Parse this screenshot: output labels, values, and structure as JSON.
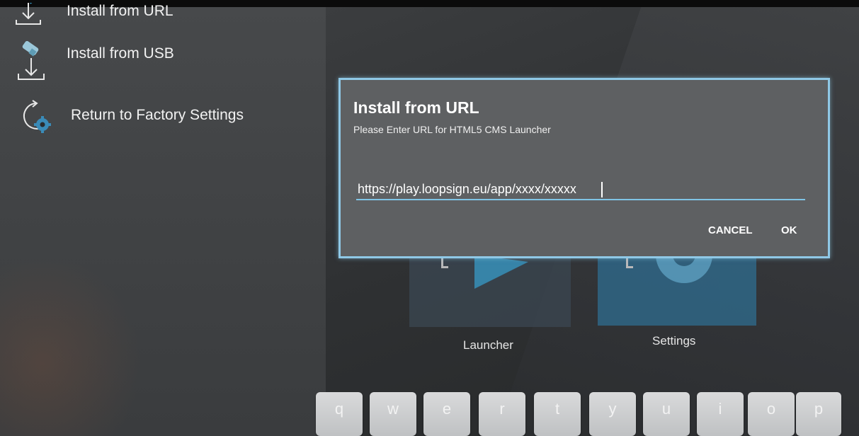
{
  "menu": {
    "items": [
      {
        "label": "Install from URL",
        "icon": "download-arrow-icon"
      },
      {
        "label": "Install from USB",
        "icon": "usb-download-icon"
      },
      {
        "label": "Return to Factory Settings",
        "icon": "factory-reset-icon"
      }
    ]
  },
  "apps": {
    "launcher": "Launcher",
    "settings": "Settings"
  },
  "dialog": {
    "title": "Install from URL",
    "subtitle": "Please Enter URL for HTML5 CMS Launcher",
    "url_value": "https://play.loopsign.eu/app/xxxx/xxxxx",
    "cancel_label": "CANCEL",
    "ok_label": "OK"
  },
  "keyboard": {
    "keys": [
      "q",
      "w",
      "e",
      "r",
      "t",
      "y",
      "u",
      "i",
      "o",
      "p"
    ]
  },
  "colors": {
    "dialog_border": "#8fc8e6",
    "accent_blue": "#3aa0d0",
    "dialog_bg": "#5e6062"
  }
}
